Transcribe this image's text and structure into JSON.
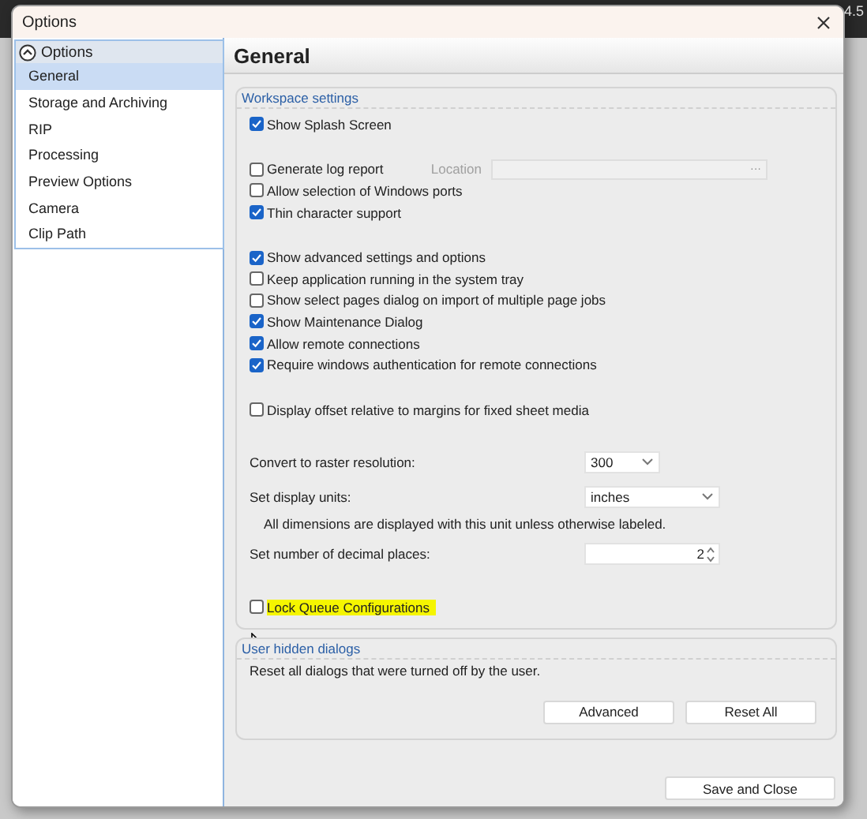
{
  "background_label": "4.5",
  "window": {
    "title": "Options"
  },
  "tree": {
    "root": {
      "label": "Options",
      "expanded": true
    },
    "items": [
      {
        "label": "General",
        "selected": true
      },
      {
        "label": "Storage and Archiving",
        "selected": false
      },
      {
        "label": "RIP",
        "selected": false
      },
      {
        "label": "Processing",
        "selected": false
      },
      {
        "label": "Preview Options",
        "selected": false
      },
      {
        "label": "Camera",
        "selected": false
      },
      {
        "label": "Clip Path",
        "selected": false
      }
    ]
  },
  "page_title": "General",
  "workspace_settings": {
    "title": "Workspace settings",
    "groups": [
      {
        "items": [
          {
            "kind": "checkbox",
            "label": "Show Splash Screen",
            "checked": true
          }
        ]
      },
      {
        "items": [
          {
            "kind": "checkbox",
            "label": "Generate log report",
            "checked": false,
            "field": {
              "label": "Location",
              "disabled": true,
              "button": "···"
            }
          },
          {
            "kind": "checkbox",
            "label": "Allow selection of Windows ports",
            "checked": false
          },
          {
            "kind": "checkbox",
            "label": "Thin character support",
            "checked": true
          }
        ]
      },
      {
        "items": [
          {
            "kind": "checkbox",
            "label": "Show advanced settings and options",
            "checked": true
          },
          {
            "kind": "checkbox",
            "label": "Keep application running in the system tray",
            "checked": false
          },
          {
            "kind": "checkbox",
            "label": "Show select pages dialog on import of multiple page jobs",
            "checked": false
          },
          {
            "kind": "checkbox",
            "label": "Show Maintenance Dialog",
            "checked": true
          },
          {
            "kind": "checkbox",
            "label": "Allow remote connections",
            "checked": true
          },
          {
            "kind": "checkbox",
            "label": "Require windows authentication for remote connections",
            "checked": true
          }
        ]
      },
      {
        "items": [
          {
            "kind": "checkbox",
            "label": "Display offset relative to margins for fixed sheet media",
            "checked": false
          }
        ]
      },
      {
        "items": [
          {
            "kind": "select",
            "label": "Convert to raster resolution:",
            "value": "300"
          },
          {
            "kind": "select",
            "label": "Set display units:",
            "value": "inches"
          },
          {
            "kind": "note",
            "text": "All dimensions are displayed with this unit unless otherwise labeled."
          },
          {
            "kind": "number",
            "label": "Set number of decimal places:",
            "value": "2"
          }
        ]
      },
      {
        "items": [
          {
            "kind": "checkbox",
            "label": "Lock Queue Configurations",
            "checked": false,
            "highlighted": true
          }
        ]
      }
    ]
  },
  "hidden_dialogs": {
    "title": "User hidden dialogs",
    "text": "Reset all dialogs that were turned off by the user.",
    "buttons": [
      "Advanced",
      "Reset All"
    ]
  },
  "footer_button": "Save and Close"
}
